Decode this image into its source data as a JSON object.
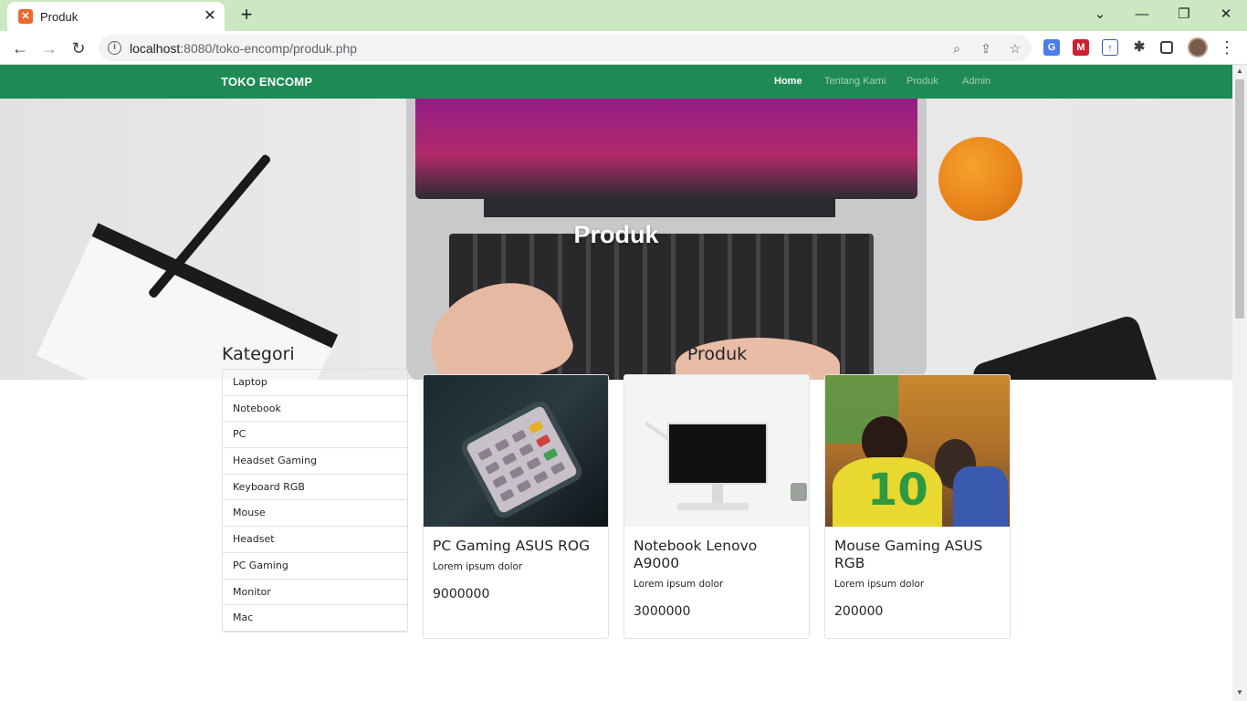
{
  "browser": {
    "tab_title": "Produk",
    "url_host": "localhost",
    "url_rest": ":8080/toko-encomp/produk.php"
  },
  "navbar": {
    "brand": "TOKO ENCOMP",
    "links": [
      "Home",
      "Tentang Kami",
      "Produk",
      "Admin"
    ],
    "active": "Home"
  },
  "hero": {
    "title": "Produk"
  },
  "sidebar": {
    "title": "Kategori",
    "items": [
      "Laptop",
      "Notebook",
      "PC",
      "Headset Gaming",
      "Keyboard RGB",
      "Mouse",
      "Headset",
      "PC Gaming",
      "Monitor",
      "Mac"
    ]
  },
  "products": {
    "title": "Produk",
    "cards": [
      {
        "name": "PC Gaming ASUS ROG",
        "desc": "Lorem ipsum dolor",
        "price": "9000000"
      },
      {
        "name": "Notebook Lenovo A9000",
        "desc": "Lorem ipsum dolor",
        "price": "3000000"
      },
      {
        "name": "Mouse Gaming ASUS RGB",
        "desc": "Lorem ipsum dolor",
        "price": "200000"
      }
    ]
  },
  "colors": {
    "navbar": "#1e8a55",
    "tabbar": "#cbe8c2"
  }
}
